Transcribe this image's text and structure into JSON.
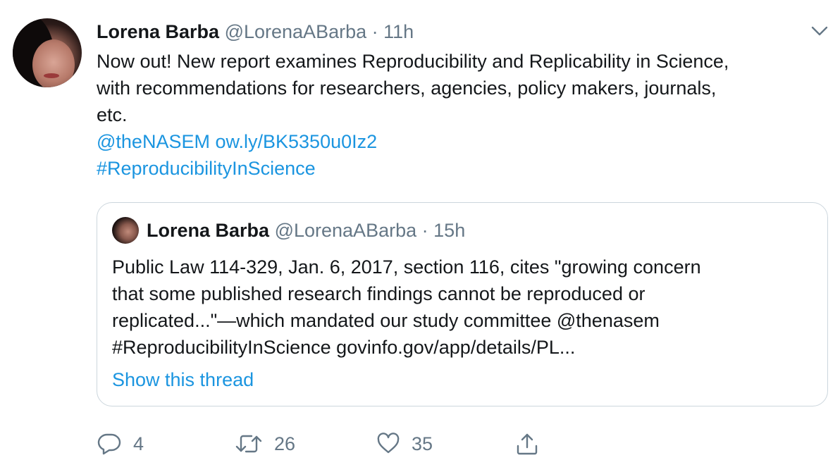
{
  "tweet": {
    "author_name": "Lorena Barba",
    "author_handle": "@LorenaABarba",
    "separator": "·",
    "time": "11h",
    "text_lines": [
      "Now out! New report examines Reproducibility and Replicability in Science,",
      "with recommendations for researchers, agencies, policy makers, journals,",
      "etc."
    ],
    "mention": "@theNASEM",
    "url": "ow.ly/BK5350u0Iz2",
    "hashtag": "#ReproducibilityInScience",
    "menu_icon": "chevron-down-icon"
  },
  "quoted_tweet": {
    "author_name": "Lorena Barba",
    "author_handle": "@LorenaABarba",
    "separator": "·",
    "time": "15h",
    "text_lines": [
      "Public Law 114-329, Jan. 6, 2017, section 116, cites \"growing concern",
      "that some published research findings cannot be reproduced or",
      "replicated...\"—which mandated our study committee @thenasem",
      "#ReproducibilityInScience govinfo.gov/app/details/PL..."
    ],
    "show_thread_label": "Show this thread"
  },
  "actions": {
    "reply_count": "4",
    "retweet_count": "26",
    "like_count": "35",
    "icons": [
      "reply-icon",
      "retweet-icon",
      "like-icon",
      "share-icon"
    ]
  },
  "colors": {
    "link": "#1b95e0",
    "muted": "#657786",
    "text": "#14171a",
    "border": "#ccd6dd"
  }
}
